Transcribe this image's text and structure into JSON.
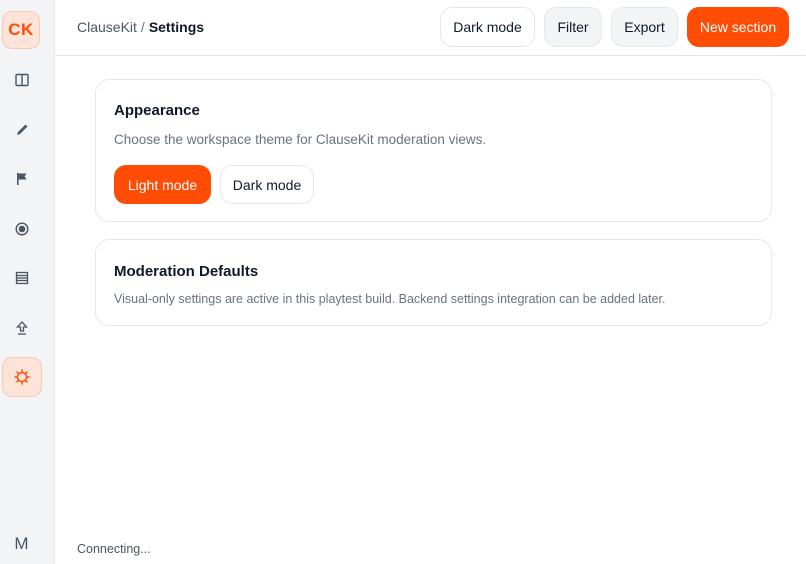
{
  "app": {
    "logo_text": "CK",
    "user_initial": "M"
  },
  "sidebar": {
    "items": [
      {
        "name": "columns-icon"
      },
      {
        "name": "pencil-icon"
      },
      {
        "name": "flag-icon"
      },
      {
        "name": "target-icon"
      },
      {
        "name": "list-icon"
      },
      {
        "name": "upload-icon"
      },
      {
        "name": "settings-gear-icon",
        "active": true
      }
    ]
  },
  "header": {
    "breadcrumb_root": "ClauseKit",
    "breadcrumb_separator": "/",
    "breadcrumb_current": "Settings",
    "buttons": {
      "dark_mode": "Dark mode",
      "filter": "Filter",
      "export": "Export",
      "new_section": "New section"
    }
  },
  "appearance": {
    "title": "Appearance",
    "description": "Choose the workspace theme for ClauseKit moderation views.",
    "options": {
      "light": "Light mode",
      "dark": "Dark mode"
    },
    "selected": "light"
  },
  "moderation": {
    "title": "Moderation Defaults",
    "description": "Visual-only settings are active in this playtest build. Backend settings integration can be added later."
  },
  "status": {
    "text": "Connecting..."
  },
  "colors": {
    "accent": "#ff4d06",
    "accent_soft": "#fde3d8",
    "border": "#e5e7eb",
    "sidebar_bg": "#f3f4f6"
  }
}
